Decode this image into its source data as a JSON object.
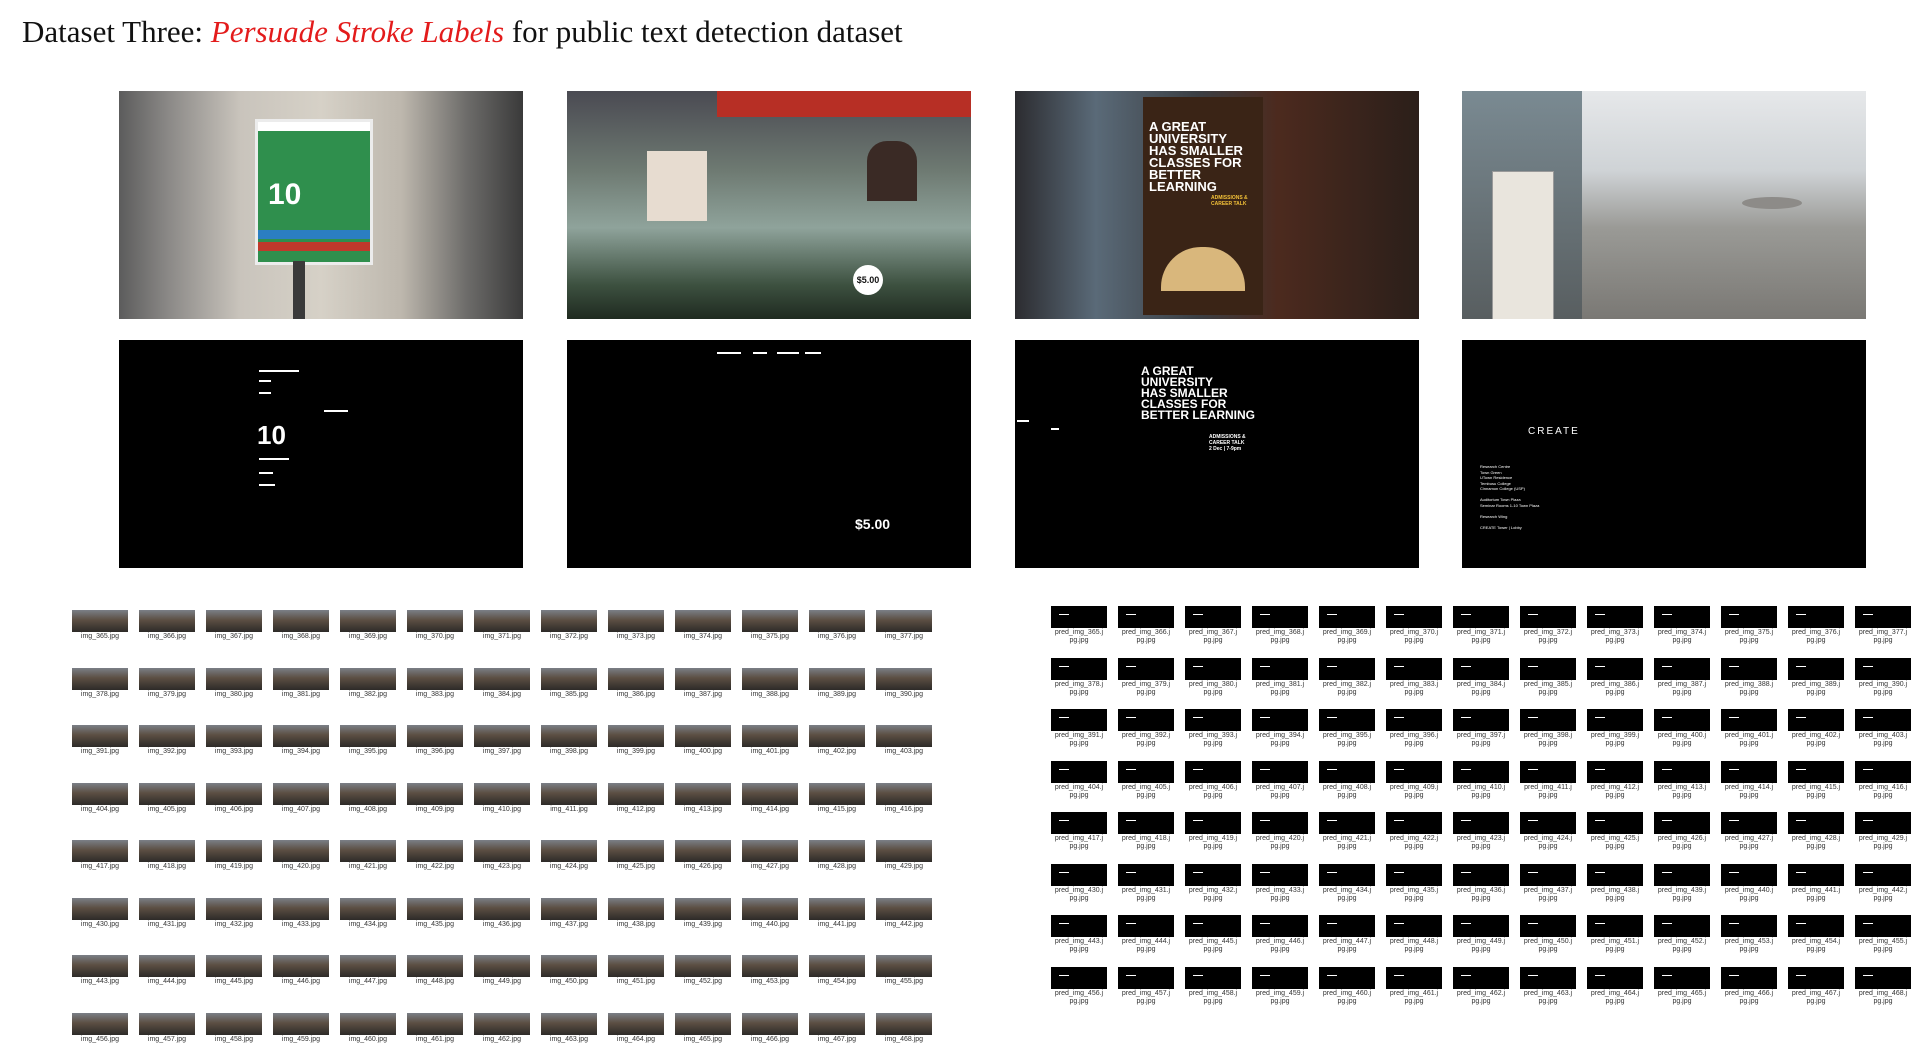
{
  "title": {
    "prefix": "Dataset Three: ",
    "highlight": "Persuade Stroke Labels",
    "suffix": " for public text detection dataset"
  },
  "photos": {
    "p1_sign_number": "10",
    "p2_price": "$5.00",
    "p3_poster": "A GREAT\nUNIVERSITY\nHAS SMALLER\nCLASSES FOR\nBETTER LEARNING",
    "p3_sub": "ADMISSIONS &\nCAREER TALK"
  },
  "masks": {
    "m1_number": "10",
    "m2_price": "$5.00",
    "m3_poster": "A GREAT\nUNIVERSITY\nHAS SMALLER\nCLASSES FOR\nBETTER LEARNING",
    "m3_sub": "ADMISSIONS &\nCAREER TALK\n2 Dec | 7-9pm",
    "m4_create": "CREATE",
    "m4_lines": "Research Centre\nTown Green\nUTown Residence\nTembusu College\nCinnamon College (USP)\n\nAuditorium  Town Plaza\nSeminar Rooms 1-10  Town Plaza\n\nResearch Wing\n\nCREATE Tower | Lobby"
  },
  "left_grid": {
    "rows": [
      [
        "img_365.jpg",
        "img_366.jpg",
        "img_367.jpg",
        "img_368.jpg",
        "img_369.jpg",
        "img_370.jpg",
        "img_371.jpg",
        "img_372.jpg",
        "img_373.jpg",
        "img_374.jpg",
        "img_375.jpg",
        "img_376.jpg",
        "img_377.jpg"
      ],
      [
        "img_378.jpg",
        "img_379.jpg",
        "img_380.jpg",
        "img_381.jpg",
        "img_382.jpg",
        "img_383.jpg",
        "img_384.jpg",
        "img_385.jpg",
        "img_386.jpg",
        "img_387.jpg",
        "img_388.jpg",
        "img_389.jpg",
        "img_390.jpg"
      ],
      [
        "img_391.jpg",
        "img_392.jpg",
        "img_393.jpg",
        "img_394.jpg",
        "img_395.jpg",
        "img_396.jpg",
        "img_397.jpg",
        "img_398.jpg",
        "img_399.jpg",
        "img_400.jpg",
        "img_401.jpg",
        "img_402.jpg",
        "img_403.jpg"
      ],
      [
        "img_404.jpg",
        "img_405.jpg",
        "img_406.jpg",
        "img_407.jpg",
        "img_408.jpg",
        "img_409.jpg",
        "img_410.jpg",
        "img_411.jpg",
        "img_412.jpg",
        "img_413.jpg",
        "img_414.jpg",
        "img_415.jpg",
        "img_416.jpg"
      ],
      [
        "img_417.jpg",
        "img_418.jpg",
        "img_419.jpg",
        "img_420.jpg",
        "img_421.jpg",
        "img_422.jpg",
        "img_423.jpg",
        "img_424.jpg",
        "img_425.jpg",
        "img_426.jpg",
        "img_427.jpg",
        "img_428.jpg",
        "img_429.jpg"
      ],
      [
        "img_430.jpg",
        "img_431.jpg",
        "img_432.jpg",
        "img_433.jpg",
        "img_434.jpg",
        "img_435.jpg",
        "img_436.jpg",
        "img_437.jpg",
        "img_438.jpg",
        "img_439.jpg",
        "img_440.jpg",
        "img_441.jpg",
        "img_442.jpg"
      ],
      [
        "img_443.jpg",
        "img_444.jpg",
        "img_445.jpg",
        "img_446.jpg",
        "img_447.jpg",
        "img_448.jpg",
        "img_449.jpg",
        "img_450.jpg",
        "img_451.jpg",
        "img_452.jpg",
        "img_453.jpg",
        "img_454.jpg",
        "img_455.jpg"
      ],
      [
        "img_456.jpg",
        "img_457.jpg",
        "img_458.jpg",
        "img_459.jpg",
        "img_460.jpg",
        "img_461.jpg",
        "img_462.jpg",
        "img_463.jpg",
        "img_464.jpg",
        "img_465.jpg",
        "img_466.jpg",
        "img_467.jpg",
        "img_468.jpg"
      ]
    ]
  },
  "right_grid": {
    "rows": [
      [
        "pred_img_365.j\npg.jpg",
        "pred_img_366.j\npg.jpg",
        "pred_img_367.j\npg.jpg",
        "pred_img_368.j\npg.jpg",
        "pred_img_369.j\npg.jpg",
        "pred_img_370.j\npg.jpg",
        "pred_img_371.j\npg.jpg",
        "pred_img_372.j\npg.jpg",
        "pred_img_373.j\npg.jpg",
        "pred_img_374.j\npg.jpg",
        "pred_img_375.j\npg.jpg",
        "pred_img_376.j\npg.jpg",
        "pred_img_377.j\npg.jpg"
      ],
      [
        "pred_img_378.j\npg.jpg",
        "pred_img_379.j\npg.jpg",
        "pred_img_380.j\npg.jpg",
        "pred_img_381.j\npg.jpg",
        "pred_img_382.j\npg.jpg",
        "pred_img_383.j\npg.jpg",
        "pred_img_384.j\npg.jpg",
        "pred_img_385.j\npg.jpg",
        "pred_img_386.j\npg.jpg",
        "pred_img_387.j\npg.jpg",
        "pred_img_388.j\npg.jpg",
        "pred_img_389.j\npg.jpg",
        "pred_img_390.j\npg.jpg"
      ],
      [
        "pred_img_391.j\npg.jpg",
        "pred_img_392.j\npg.jpg",
        "pred_img_393.j\npg.jpg",
        "pred_img_394.j\npg.jpg",
        "pred_img_395.j\npg.jpg",
        "pred_img_396.j\npg.jpg",
        "pred_img_397.j\npg.jpg",
        "pred_img_398.j\npg.jpg",
        "pred_img_399.j\npg.jpg",
        "pred_img_400.j\npg.jpg",
        "pred_img_401.j\npg.jpg",
        "pred_img_402.j\npg.jpg",
        "pred_img_403.j\npg.jpg"
      ],
      [
        "pred_img_404.j\npg.jpg",
        "pred_img_405.j\npg.jpg",
        "pred_img_406.j\npg.jpg",
        "pred_img_407.j\npg.jpg",
        "pred_img_408.j\npg.jpg",
        "pred_img_409.j\npg.jpg",
        "pred_img_410.j\npg.jpg",
        "pred_img_411.j\npg.jpg",
        "pred_img_412.j\npg.jpg",
        "pred_img_413.j\npg.jpg",
        "pred_img_414.j\npg.jpg",
        "pred_img_415.j\npg.jpg",
        "pred_img_416.j\npg.jpg"
      ],
      [
        "pred_img_417.j\npg.jpg",
        "pred_img_418.j\npg.jpg",
        "pred_img_419.j\npg.jpg",
        "pred_img_420.j\npg.jpg",
        "pred_img_421.j\npg.jpg",
        "pred_img_422.j\npg.jpg",
        "pred_img_423.j\npg.jpg",
        "pred_img_424.j\npg.jpg",
        "pred_img_425.j\npg.jpg",
        "pred_img_426.j\npg.jpg",
        "pred_img_427.j\npg.jpg",
        "pred_img_428.j\npg.jpg",
        "pred_img_429.j\npg.jpg"
      ],
      [
        "pred_img_430.j\npg.jpg",
        "pred_img_431.j\npg.jpg",
        "pred_img_432.j\npg.jpg",
        "pred_img_433.j\npg.jpg",
        "pred_img_434.j\npg.jpg",
        "pred_img_435.j\npg.jpg",
        "pred_img_436.j\npg.jpg",
        "pred_img_437.j\npg.jpg",
        "pred_img_438.j\npg.jpg",
        "pred_img_439.j\npg.jpg",
        "pred_img_440.j\npg.jpg",
        "pred_img_441.j\npg.jpg",
        "pred_img_442.j\npg.jpg"
      ],
      [
        "pred_img_443.j\npg.jpg",
        "pred_img_444.j\npg.jpg",
        "pred_img_445.j\npg.jpg",
        "pred_img_446.j\npg.jpg",
        "pred_img_447.j\npg.jpg",
        "pred_img_448.j\npg.jpg",
        "pred_img_449.j\npg.jpg",
        "pred_img_450.j\npg.jpg",
        "pred_img_451.j\npg.jpg",
        "pred_img_452.j\npg.jpg",
        "pred_img_453.j\npg.jpg",
        "pred_img_454.j\npg.jpg",
        "pred_img_455.j\npg.jpg"
      ],
      [
        "pred_img_456.j\npg.jpg",
        "pred_img_457.j\npg.jpg",
        "pred_img_458.j\npg.jpg",
        "pred_img_459.j\npg.jpg",
        "pred_img_460.j\npg.jpg",
        "pred_img_461.j\npg.jpg",
        "pred_img_462.j\npg.jpg",
        "pred_img_463.j\npg.jpg",
        "pred_img_464.j\npg.jpg",
        "pred_img_465.j\npg.jpg",
        "pred_img_466.j\npg.jpg",
        "pred_img_467.j\npg.jpg",
        "pred_img_468.j\npg.jpg"
      ]
    ]
  }
}
